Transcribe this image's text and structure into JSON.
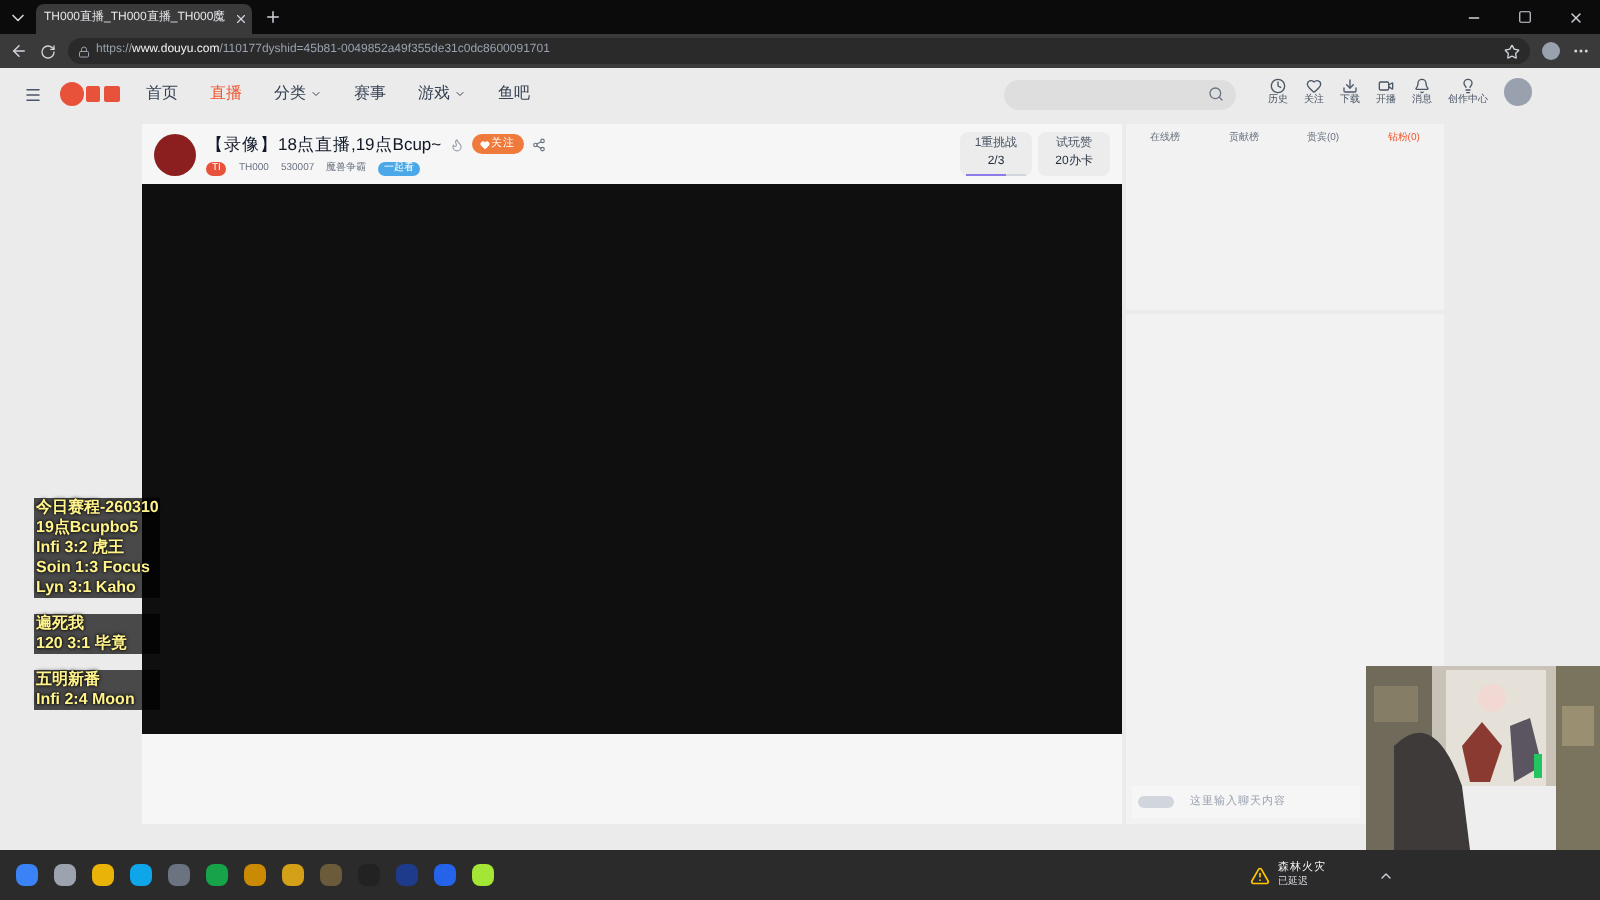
{
  "browser": {
    "tab_title": "TH000直播_TH000直播_TH000魔",
    "url_prefix": "https://",
    "url_host": "www.douyu.com",
    "url_path": "/110177dyshid=45b81-0049852a49f355de31c0dc8600091701"
  },
  "nav": [
    {
      "label": "首页",
      "selected": false,
      "dropdown": false
    },
    {
      "label": "直播",
      "selected": true,
      "dropdown": false
    },
    {
      "label": "分类",
      "selected": false,
      "dropdown": true
    },
    {
      "label": "赛事",
      "selected": false,
      "dropdown": false
    },
    {
      "label": "游戏",
      "selected": false,
      "dropdown": true
    },
    {
      "label": "鱼吧",
      "selected": false,
      "dropdown": false
    }
  ],
  "header_actions": [
    {
      "kind": "history",
      "label": "历史"
    },
    {
      "kind": "follow",
      "label": "关注"
    },
    {
      "kind": "download",
      "label": "下载"
    },
    {
      "kind": "broadcast",
      "label": "开播"
    },
    {
      "kind": "message",
      "label": "消息"
    },
    {
      "kind": "creator",
      "label": "创作中心"
    }
  ],
  "stream": {
    "title": "【录像】18点直播,19点Bcup~",
    "follow_label": "关注",
    "level": "TI",
    "streamer": "TH000",
    "views": "530007",
    "category": "魔兽争霸",
    "tag": "一起看"
  },
  "stats": [
    {
      "label": "1重挑战",
      "value": "2/3",
      "level": 0.66
    },
    {
      "label": "试玩赞",
      "value": "20办卡"
    }
  ],
  "rank_tabs": [
    {
      "label": "在线榜",
      "selected": false
    },
    {
      "label": "贡献榜",
      "selected": false
    },
    {
      "label": "贵宾(0)",
      "selected": false
    },
    {
      "label": "钻粉(0)",
      "selected": true
    }
  ],
  "chat_placeholder": "这里输入聊天内容",
  "overlay_groups": [
    [
      "今日赛程-260310",
      "19点Bcupbo5",
      "Infi 3:2 虎王",
      "Soin 1:3 Focus",
      "Lyn 3:1 Kaho"
    ],
    [
      "遍死我",
      "120 3:1 毕竟"
    ],
    [
      "五明新番",
      "Infi 2:4 Moon"
    ]
  ],
  "tray_notification": {
    "title": "森林火灾",
    "subtitle": "已延迟"
  }
}
